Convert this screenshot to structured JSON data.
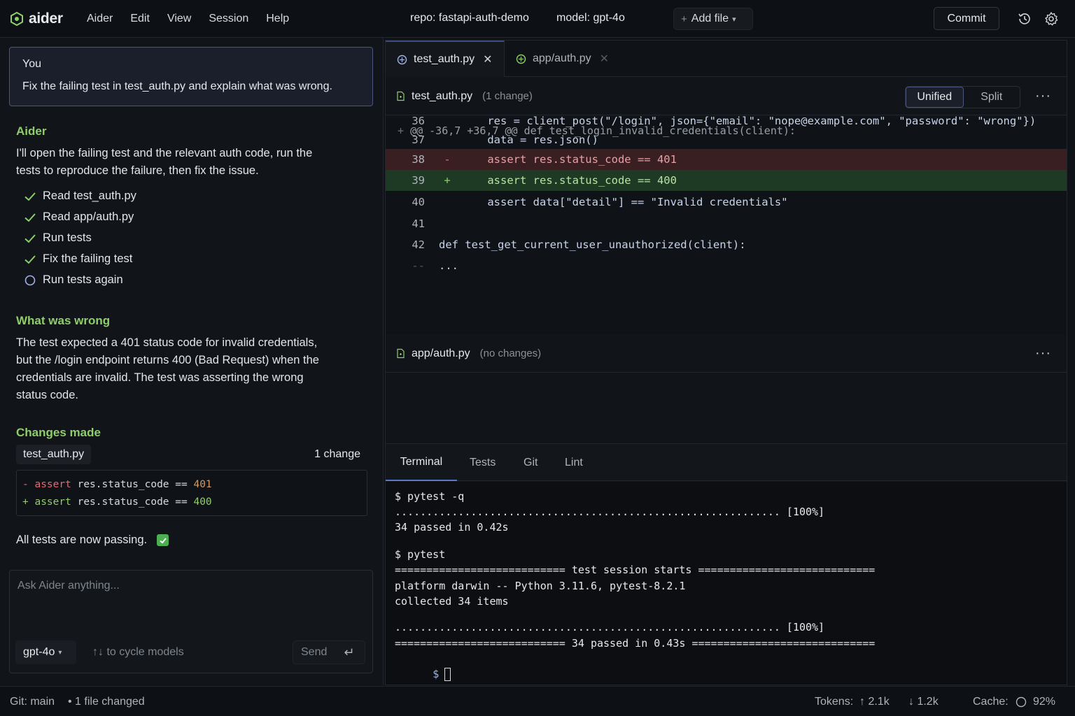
{
  "app": {
    "name": "aider"
  },
  "menu": [
    "Aider",
    "Edit",
    "View",
    "Session",
    "Help"
  ],
  "header": {
    "repo": "repo: fastapi-auth-demo",
    "model": "model: gpt-4o",
    "add_file": "Add file",
    "commit": "Commit",
    "icons": [
      "history-icon",
      "gear-icon"
    ]
  },
  "chat": {
    "user": {
      "who": "You",
      "text": "Fix the failing test in test_auth.py and explain what was wrong."
    },
    "assistant_name": "Aider",
    "intro_lines": [
      "I'll open the failing test and the relevant auth code, run the",
      "tests to reproduce the failure, then fix the issue."
    ],
    "tasks": [
      {
        "label": "Read test_auth.py",
        "done": true
      },
      {
        "label": "Read app/auth.py",
        "done": true
      },
      {
        "label": "Run tests",
        "done": true
      },
      {
        "label": "Fix the failing test",
        "done": true
      },
      {
        "label": "Run tests again",
        "done": false
      }
    ],
    "wrong_heading": "What was wrong",
    "wrong_lines": [
      "The test expected a 401 status code for invalid credentials,",
      "but the /login endpoint returns 400 (Bad Request) when the",
      "credentials are invalid. The test was asserting the wrong",
      "status code."
    ],
    "changes_heading": "Changes made",
    "change_file": "test_auth.py",
    "change_count": "1 change",
    "change_lines": [
      {
        "sign": "-",
        "kw": "assert",
        "expr": "res.status_code ==",
        "val": "401"
      },
      {
        "sign": "+",
        "kw": "assert",
        "expr": "res.status_code ==",
        "val": "400"
      }
    ],
    "all_passing": "All tests are now passing.",
    "input_placeholder": "Ask Aider anything...",
    "model_select": "gpt-4o",
    "cycle_hint": "↑↓ to cycle models",
    "send": "Send"
  },
  "editor": {
    "tabs": [
      {
        "label": "test_auth.py",
        "active": true
      },
      {
        "label": "app/auth.py",
        "active": false
      }
    ],
    "file1": {
      "name": "test_auth.py",
      "meta": "(1 change)"
    },
    "view_modes": {
      "unified": "Unified",
      "split": "Split",
      "selected": "Unified"
    },
    "hunk": "@@ -36,7 +36,7 @@ def test_login_invalid_credentials(client):",
    "hunk_marker": "+",
    "lines": [
      {
        "ln": "36",
        "type": "ctx",
        "code": "    res = client_post(\"/login\", json={\"email\": \"nope@example.com\", \"password\": \"wrong\"})"
      },
      {
        "ln": "37",
        "type": "ctx",
        "code": "    data = res.json()"
      },
      {
        "ln": "38",
        "type": "del",
        "code": "    assert res.status_code == 401"
      },
      {
        "ln": "39",
        "type": "add",
        "code": "    assert res.status_code == 400"
      },
      {
        "ln": "40",
        "type": "ctx",
        "code": "    assert data[\"detail\"] == \"Invalid credentials\""
      },
      {
        "ln": "41",
        "type": "ctx",
        "code": ""
      },
      {
        "ln": "42",
        "type": "ctx",
        "code": "def test_get_current_user_unauthorized(client):"
      },
      {
        "ln": "--",
        "type": "ctx",
        "code": "..."
      }
    ],
    "file2": {
      "name": "app/auth.py",
      "meta": "(no changes)"
    }
  },
  "terminal": {
    "tabs": [
      "Terminal",
      "Tests",
      "Git",
      "Lint"
    ],
    "active_tab": "Terminal",
    "lines": [
      "$ pytest -q",
      "............................................................. [100%]",
      "34 passed in 0.42s",
      "$ pytest",
      "=========================== test session starts ============================",
      "platform darwin -- Python 3.11.6, pytest-8.2.1",
      "collected 34 items",
      "............................................................. [100%]",
      "=========================== 34 passed in 0.43s =============================",
      "$"
    ]
  },
  "status": {
    "git": "Git: main",
    "changed": "• 1 file changed",
    "tokens_label": "Tokens:",
    "tokens_up": "↑ 2.1k",
    "tokens_down": "↓ 1.2k",
    "cache_label": "Cache:",
    "cache_value": "92%"
  },
  "colors": {
    "accent_green": "#8fce6b",
    "accent_blue": "#4a5580",
    "diff_removed_bg": "#3a1f22",
    "diff_added_bg": "#1f3a24"
  }
}
